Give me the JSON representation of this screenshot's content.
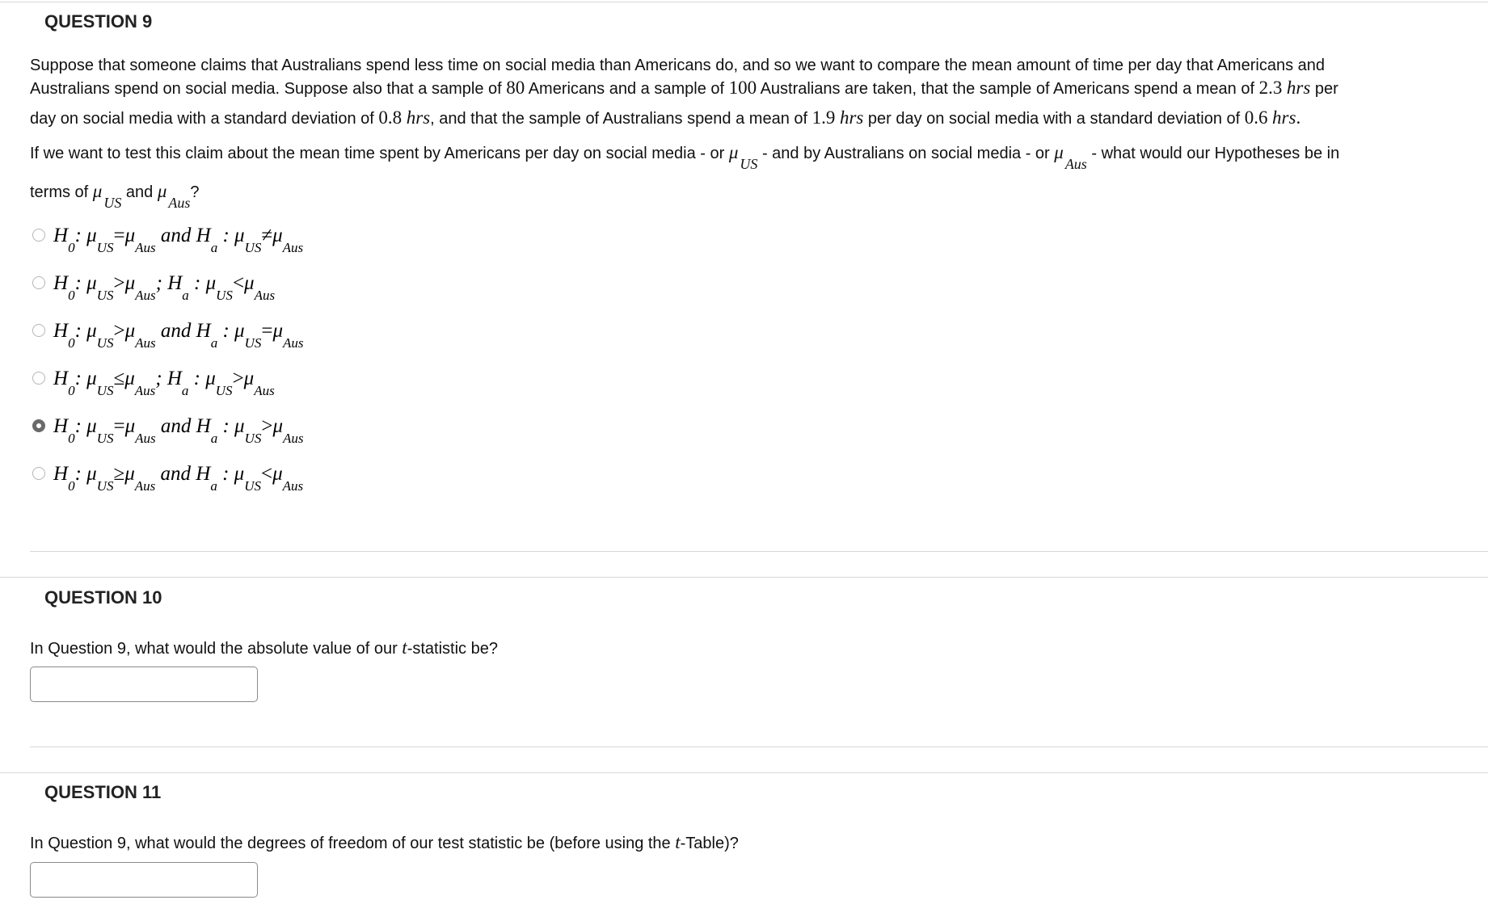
{
  "q9": {
    "title": "QUESTION 9",
    "p1_line1": "Suppose that someone claims that Australians spend less time on social media than Americans do, and so we want to compare the mean amount of time per day that Americans and",
    "p1_line2_a": "Australians spend on social media. Suppose also that a sample of ",
    "n_us": "80",
    "p1_line2_b": " Americans and a sample of ",
    "n_aus": "100",
    "p1_line2_c": " Australians are taken, that the sample of Americans spend a mean of ",
    "mean_us": "2.3",
    "hrs": "hrs",
    "p1_line2_d": " per",
    "p1_line3_a": "day on social media with a standard deviation of ",
    "sd_us": "0.8",
    "p1_line3_b": ", and that the sample of Australians spend a mean of ",
    "mean_aus": "1.9",
    "p1_line3_c": " per day on social media with a standard deviation of ",
    "sd_aus": "0.6",
    "p2_line1_a": "If we want to test this claim about the mean time spent by Americans per day on social media - or ",
    "p2_line1_b": " - and by Australians on social media - or ",
    "p2_line1_c": " - what would our Hypotheses be in",
    "p2_line2_a": "terms of ",
    "p2_line2_b": " and ",
    "p2_line2_c": "?",
    "mu": "μ",
    "sub_us": "US",
    "sub_aus": "Aus",
    "options": [
      {
        "h0_op": "=",
        "joiner": "and",
        "ha_op": "≠",
        "selected": false
      },
      {
        "h0_op": ">",
        "joiner": ";",
        "ha_op": "<",
        "selected": false
      },
      {
        "h0_op": ">",
        "joiner": "and",
        "ha_op": "=",
        "selected": false
      },
      {
        "h0_op": "≤",
        "joiner": ";",
        "ha_op": ">",
        "selected": false
      },
      {
        "h0_op": "=",
        "joiner": "and",
        "ha_op": ">",
        "selected": true
      },
      {
        "h0_op": "≥",
        "joiner": "and",
        "ha_op": "<",
        "selected": false
      }
    ]
  },
  "q10": {
    "title": "QUESTION 10",
    "text_a": "In Question 9, what would the absolute value of our ",
    "t": "t",
    "text_b": "-statistic be?",
    "answer_value": ""
  },
  "q11": {
    "title": "QUESTION 11",
    "text_a": "In Question 9, what would the degrees of freedom of our test statistic be (before using the ",
    "t": "t",
    "text_b": "-Table)?",
    "answer_value": ""
  }
}
